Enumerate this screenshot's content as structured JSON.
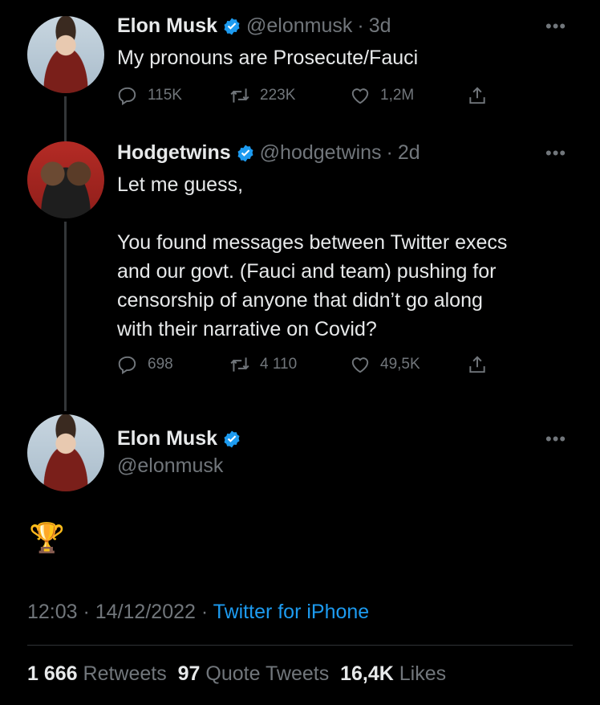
{
  "tweets": [
    {
      "display_name": "Elon Musk",
      "handle": "@elonmusk",
      "time": "3d",
      "text": "My pronouns are Prosecute/Fauci",
      "replies": "115K",
      "retweets": "223K",
      "likes": "1,2M"
    },
    {
      "display_name": "Hodgetwins",
      "handle": "@hodgetwins",
      "time": "2d",
      "text": "Let me guess,\n\nYou found messages between Twitter execs\nand our govt. (Fauci and team) pushing for\ncensorship of anyone that didn’t go along\nwith their narrative on Covid?",
      "replies": "698",
      "retweets": "4 110",
      "likes": "49,5K"
    }
  ],
  "main": {
    "display_name": "Elon Musk",
    "handle": "@elonmusk",
    "text": "🏆",
    "timestamp": "12:03 · 14/12/2022 ·",
    "source": "Twitter for iPhone",
    "retweets_count": "1 666",
    "retweets_label": "Retweets",
    "quotes_count": "97",
    "quotes_label": "Quote Tweets",
    "likes_count": "16,4K",
    "likes_label": "Likes"
  },
  "more_glyph": "•••",
  "separator": "·",
  "colors": {
    "verified": "#1d9bf0",
    "link": "#1d9bf0",
    "muted": "#71767b"
  }
}
